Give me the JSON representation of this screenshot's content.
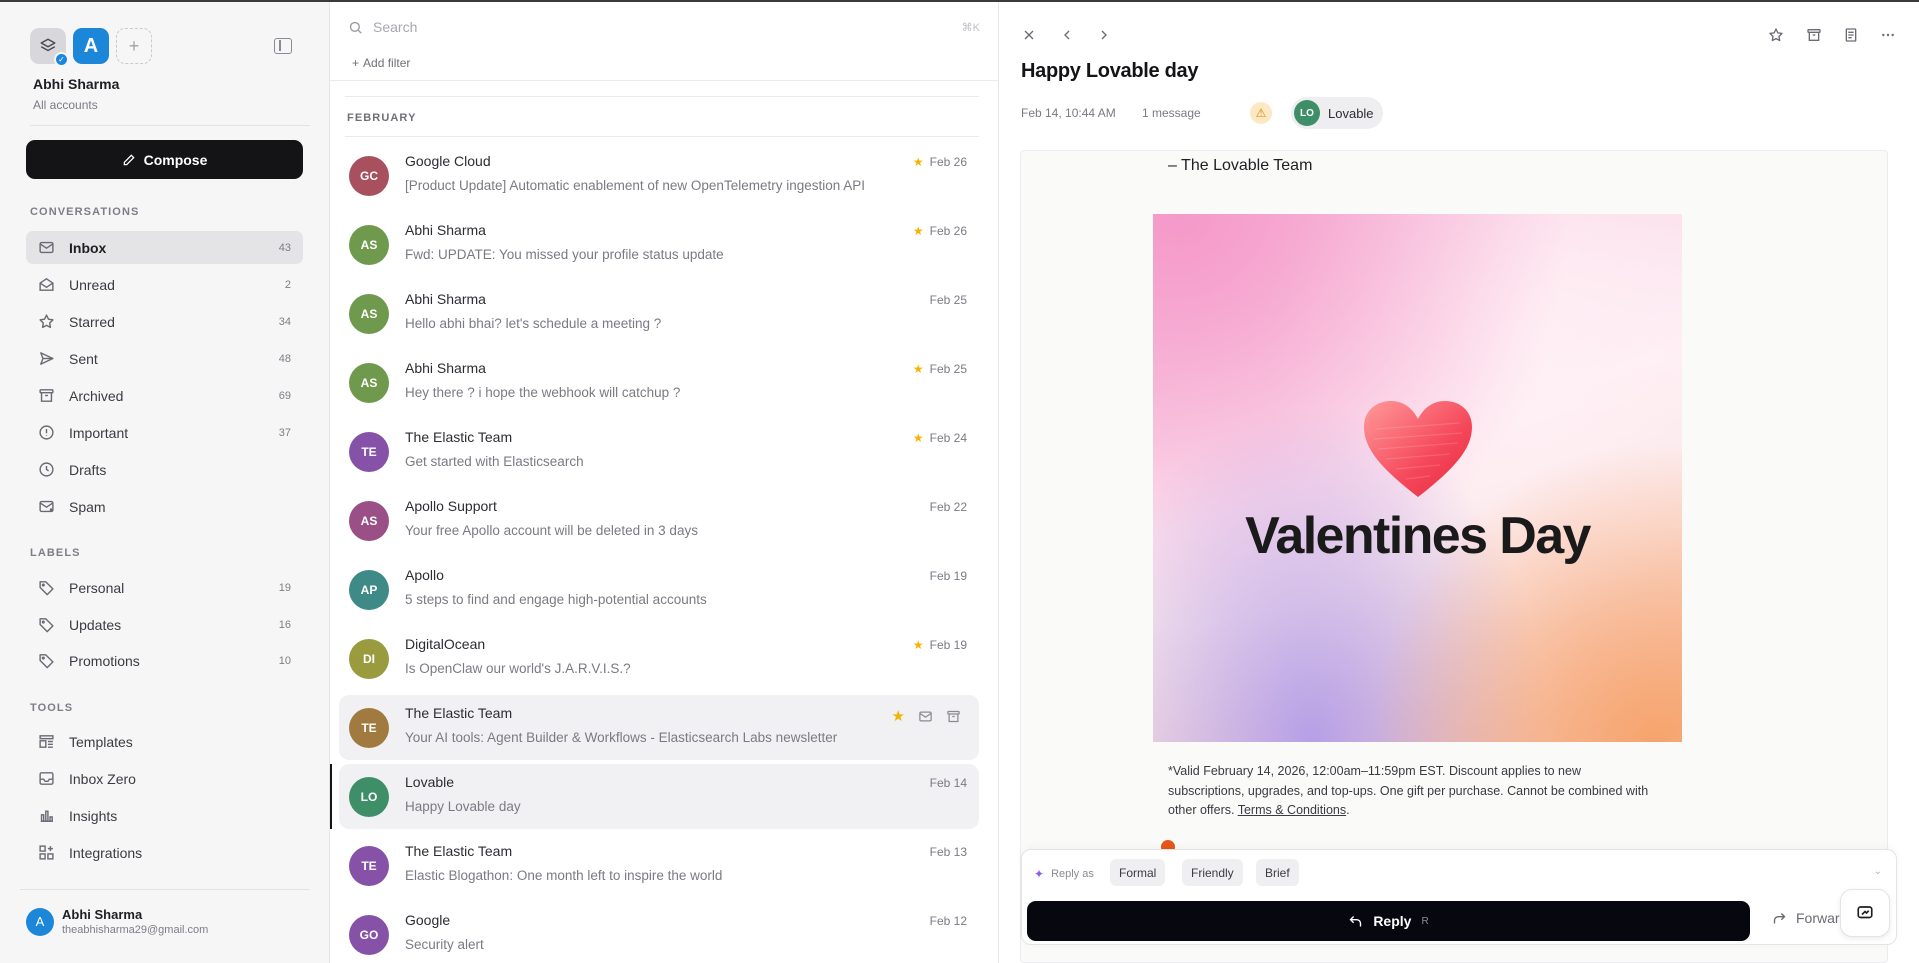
{
  "sidebar": {
    "account_initial": "A",
    "user_name": "Abhi Sharma",
    "user_sub": "All accounts",
    "compose_label": "Compose",
    "conversations_title": "CONVERSATIONS",
    "nav": [
      {
        "label": "Inbox",
        "count": "43",
        "icon": "inbox-icon"
      },
      {
        "label": "Unread",
        "count": "2",
        "icon": "mail-open-icon"
      },
      {
        "label": "Starred",
        "count": "34",
        "icon": "star-icon"
      },
      {
        "label": "Sent",
        "count": "48",
        "icon": "send-icon"
      },
      {
        "label": "Archived",
        "count": "69",
        "icon": "archive-icon"
      },
      {
        "label": "Important",
        "count": "37",
        "icon": "alert-circle-icon"
      },
      {
        "label": "Drafts",
        "count": "",
        "icon": "clock-icon"
      },
      {
        "label": "Spam",
        "count": "",
        "icon": "spam-icon"
      }
    ],
    "labels_title": "LABELS",
    "labels": [
      {
        "label": "Personal",
        "count": "19"
      },
      {
        "label": "Updates",
        "count": "16"
      },
      {
        "label": "Promotions",
        "count": "10"
      }
    ],
    "tools_title": "TOOLS",
    "tools": [
      {
        "label": "Templates",
        "icon": "templates-icon"
      },
      {
        "label": "Inbox Zero",
        "icon": "inbox-zero-icon"
      },
      {
        "label": "Insights",
        "icon": "chart-icon"
      },
      {
        "label": "Integrations",
        "icon": "integrations-icon"
      }
    ],
    "footer": {
      "initial": "A",
      "name": "Abhi Sharma",
      "email": "theabhisharma29@gmail.com"
    }
  },
  "list": {
    "search_placeholder": "Search",
    "search_kbd": "⌘K",
    "add_filter": "Add filter",
    "month": "FEBRUARY",
    "messages": [
      {
        "initials": "GC",
        "color": "#a8505e",
        "sender": "Google Cloud",
        "subject": "[Product Update] Automatic enablement of new OpenTelemetry ingestion API",
        "date": "Feb 26",
        "starred": true
      },
      {
        "initials": "AS",
        "color": "#6f9a4e",
        "sender": "Abhi Sharma",
        "subject": "Fwd: UPDATE: You missed your profile status update",
        "date": "Feb 26",
        "starred": true
      },
      {
        "initials": "AS",
        "color": "#6f9a4e",
        "sender": "Abhi Sharma",
        "subject": "Hello abhi bhai? let's schedule a meeting ?",
        "date": "Feb 25",
        "starred": false
      },
      {
        "initials": "AS",
        "color": "#6f9a4e",
        "sender": "Abhi Sharma",
        "subject": "Hey there ? i hope the webhook will catchup ?",
        "date": "Feb 25",
        "starred": true
      },
      {
        "initials": "TE",
        "color": "#8552a8",
        "sender": "The Elastic Team",
        "subject": "Get started with Elasticsearch",
        "date": "Feb 24",
        "starred": true
      },
      {
        "initials": "AS",
        "color": "#9a4f86",
        "sender": "Apollo Support",
        "subject": "Your free Apollo account will be deleted in 3 days",
        "date": "Feb 22",
        "starred": false
      },
      {
        "initials": "AP",
        "color": "#3e8a86",
        "sender": "Apollo",
        "subject": "5 steps to find and engage high-potential accounts",
        "date": "Feb 19",
        "starred": false
      },
      {
        "initials": "DI",
        "color": "#9a9a3e",
        "sender": "DigitalOcean",
        "subject": "Is OpenClaw our world's J.A.R.V.I.S.?",
        "date": "Feb 19",
        "starred": true
      },
      {
        "initials": "TE",
        "color": "#a07a3e",
        "sender": "The Elastic Team",
        "subject": "Your AI tools: Agent Builder & Workflows - Elasticsearch Labs newsletter",
        "date": "",
        "starred": true,
        "hover": true
      },
      {
        "initials": "LO",
        "color": "#3e8f68",
        "sender": "Lovable",
        "subject": "Happy Lovable day",
        "date": "Feb 14",
        "starred": false,
        "selected": true
      },
      {
        "initials": "TE",
        "color": "#8552a8",
        "sender": "The Elastic Team",
        "subject": "Elastic Blogathon: One month left to inspire the world",
        "date": "Feb 13",
        "starred": false
      },
      {
        "initials": "GO",
        "color": "#8552a8",
        "sender": "Google",
        "subject": "Security alert",
        "date": "Feb 12",
        "starred": false
      }
    ]
  },
  "pane": {
    "title": "Happy Lovable day",
    "date": "Feb 14, 10:44 AM",
    "message_count": "1 message",
    "sender_initials": "LO",
    "sender_name": "Lovable",
    "signoff": "– The Lovable Team",
    "promo_text": "Valentines Day",
    "fine_print": "*Valid February 14, 2026, 12:00am–11:59pm EST. Discount applies to new subscriptions, upgrades, and top-ups. One gift per purchase. Cannot be combined with other offers.",
    "terms_link": "Terms & Conditions",
    "reply_as": "Reply as",
    "tones": [
      "Formal",
      "Friendly",
      "Brief"
    ],
    "reply_label": "Reply",
    "reply_kbd": "R",
    "forward_label": "Forward"
  },
  "colors": {
    "accent": "#1c86d8",
    "compose_bg": "#141417",
    "star": "#f5b400"
  }
}
